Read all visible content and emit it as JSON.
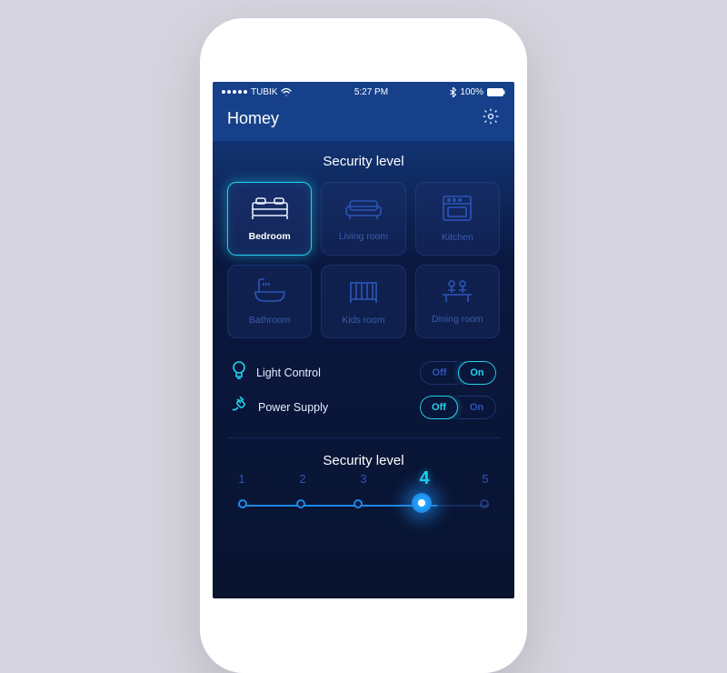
{
  "status": {
    "carrier": "TUBIK",
    "time": "5:27 PM",
    "battery": "100%"
  },
  "header": {
    "title": "Homey"
  },
  "rooms_section": {
    "title": "Security level"
  },
  "rooms": [
    {
      "label": "Bedroom",
      "active": true
    },
    {
      "label": "Living room"
    },
    {
      "label": "Kitchen"
    },
    {
      "label": "Bathroom"
    },
    {
      "label": "Kids room"
    },
    {
      "label": "Dining room"
    }
  ],
  "controls": {
    "light": {
      "label": "Light Control",
      "off": "Off",
      "on": "On",
      "value": "On"
    },
    "power": {
      "label": "Power Supply",
      "off": "Off",
      "on": "On",
      "value": "Off"
    }
  },
  "slider": {
    "title": "Security level",
    "levels": [
      "1",
      "2",
      "3",
      "4",
      "5"
    ],
    "selected": 4
  }
}
